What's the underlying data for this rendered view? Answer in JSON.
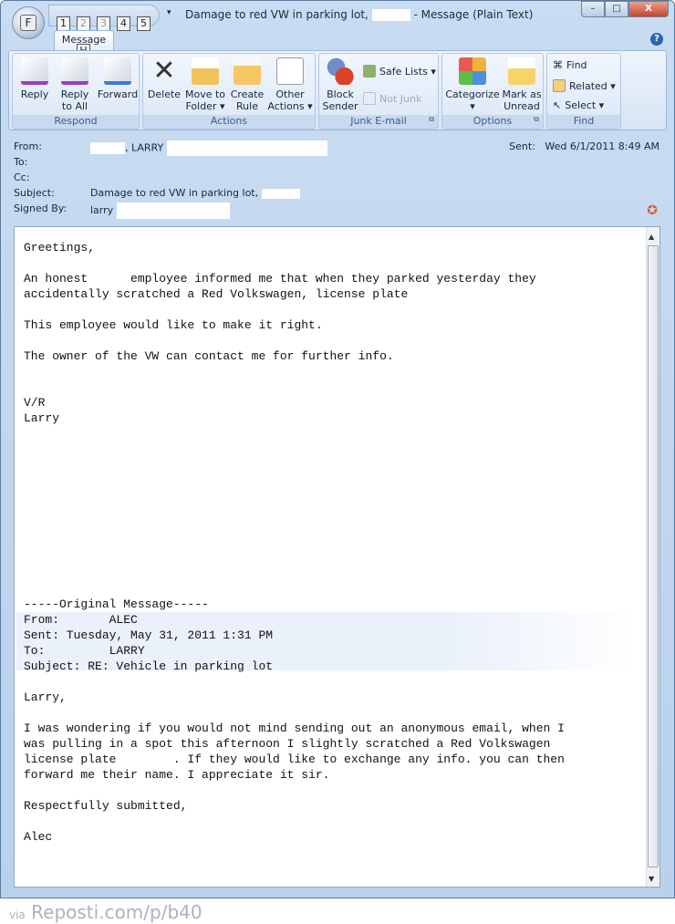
{
  "window": {
    "title_prefix": "Damage to red VW in parking lot,",
    "title_suffix": "- Message (Plain Text)",
    "office_button_key": "F",
    "qat_keys": [
      "1",
      "2",
      "3",
      "4",
      "5"
    ],
    "minimize": "–",
    "restore": "□",
    "close": "X"
  },
  "ribbon": {
    "tab": "Message",
    "tab_key": "H",
    "help": "?",
    "groups": {
      "respond": {
        "label": "Respond",
        "buttons": [
          "Reply",
          "Reply\nto All",
          "Forward"
        ]
      },
      "actions": {
        "label": "Actions",
        "buttons": [
          "Delete",
          "Move to\nFolder ▾",
          "Create\nRule",
          "Other\nActions ▾"
        ]
      },
      "junk": {
        "label": "Junk E-mail",
        "block": "Block\nSender",
        "safe_lists": "Safe Lists ▾",
        "not_junk": "Not Junk"
      },
      "options": {
        "label": "Options",
        "categorize": "Categorize\n▾",
        "mark_unread": "Mark as\nUnread"
      },
      "find": {
        "label": "Find",
        "find": "Find",
        "related": "Related ▾",
        "select": "Select ▾"
      }
    }
  },
  "header": {
    "from_label": "From:",
    "from_value": ", LARRY",
    "to_label": "To:",
    "cc_label": "Cc:",
    "subject_label": "Subject:",
    "subject_value": "Damage to red VW in parking lot,",
    "signed_label": "Signed By:",
    "signed_value": "larry",
    "sent_label": "Sent:",
    "sent_value": "Wed 6/1/2011 8:49 AM",
    "signature_icon": "certificate-ribbon-icon"
  },
  "body": {
    "text": "Greetings,\n\nAn honest      employee informed me that when they parked yesterday they\naccidentally scratched a Red Volkswagen, license plate\n\nThis employee would like to make it right.\n\nThe owner of the VW can contact me for further info.\n\n\nV/R\nLarry\n\n\n\n\n\n\n\n\n\n\n\n-----Original Message-----\nFrom:       ALEC\nSent: Tuesday, May 31, 2011 1:31 PM\nTo:         LARRY\nSubject: RE: Vehicle in parking lot\n\nLarry,\n\nI was wondering if you would not mind sending out an anonymous email, when I\nwas pulling in a spot this afternoon I slightly scratched a Red Volkswagen\nlicense plate        . If they would like to exchange any info. you can then\nforward me their name. I appreciate it sir.\n\nRespectfully submitted,\n\nAlec"
  },
  "watermark": {
    "via": "via",
    "site": "Reposti.com/p/b40"
  }
}
